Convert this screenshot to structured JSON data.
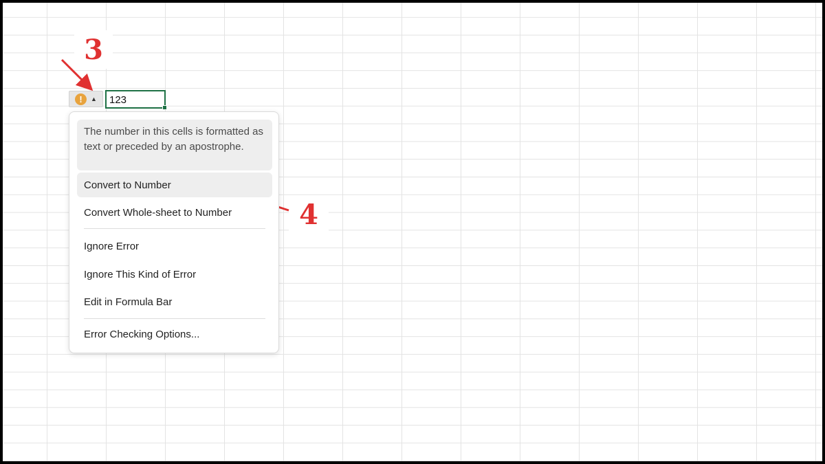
{
  "annotations": {
    "step3": "3",
    "step4": "4",
    "color": "#e03131"
  },
  "cell": {
    "value": "123",
    "border_color": "#1e7145"
  },
  "error_widget": {
    "icon": "warning-icon",
    "icon_glyph": "!",
    "caret_icon": "caret-up-icon",
    "icon_color": "#e8a33d"
  },
  "menu": {
    "message": "The number in this cells is formatted as text or preceded by an apostrophe.",
    "items": [
      {
        "label": "Convert to Number"
      },
      {
        "label": "Convert Whole-sheet to Number"
      },
      {
        "label": "Ignore Error"
      },
      {
        "label": "Ignore This Kind of Error"
      },
      {
        "label": "Edit in Formula Bar"
      },
      {
        "label": "Error Checking Options..."
      }
    ]
  }
}
